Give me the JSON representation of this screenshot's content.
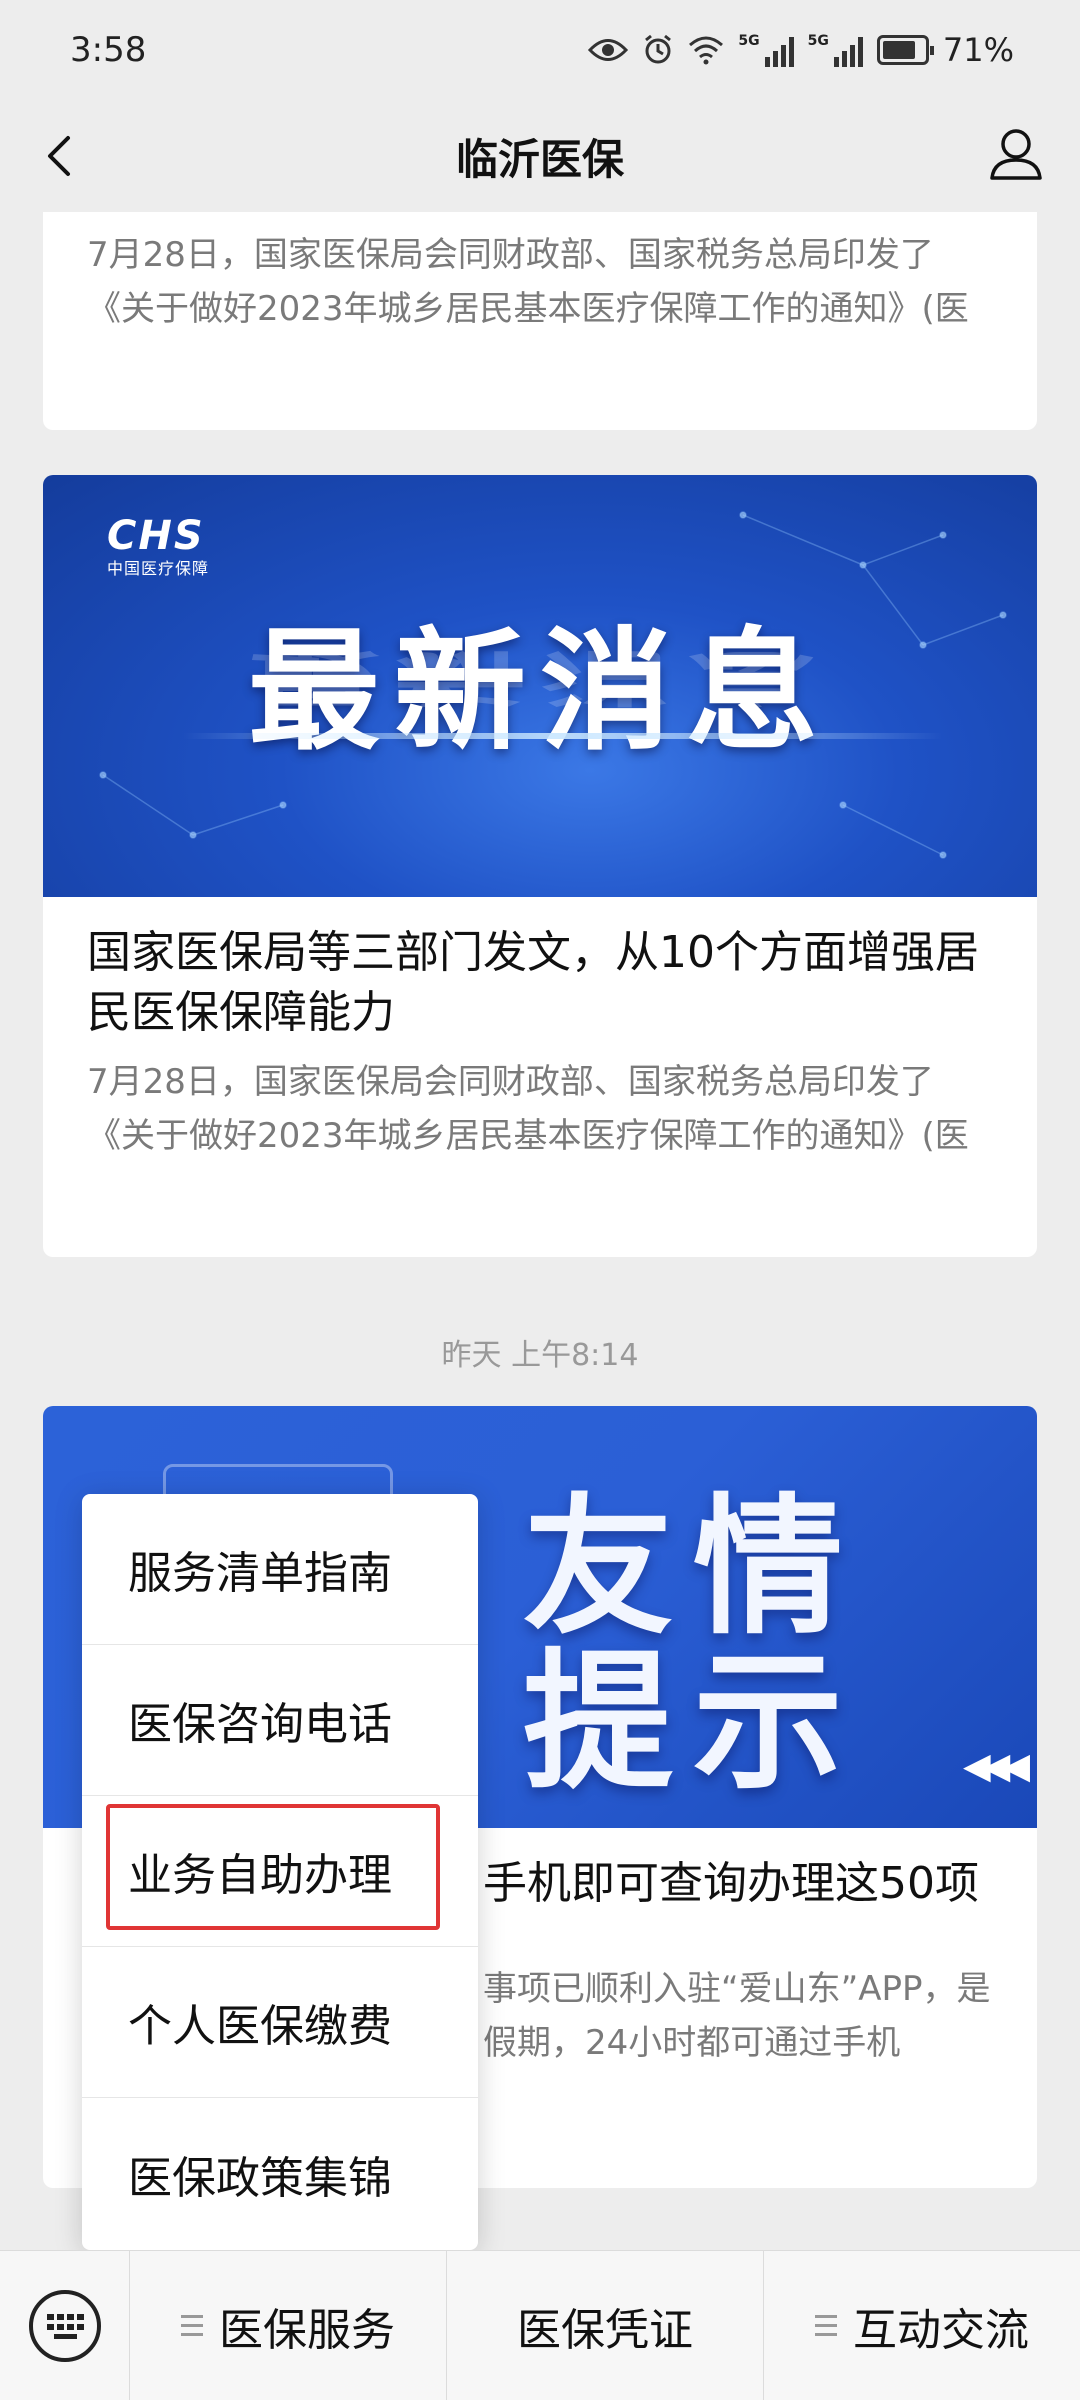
{
  "status_bar": {
    "time": "3:58",
    "battery": "71%",
    "net1": "5G",
    "net2": "5G"
  },
  "header": {
    "title": "临沂医保"
  },
  "articles": [
    {
      "summary": "7月28日，国家医保局会同财政部、国家税务总局印发了《关于做好2023年城乡居民基本医疗保障工作的通知》(医"
    },
    {
      "banner_title": "最新消息",
      "banner_logo": "CHS",
      "banner_logo_sub": "中国医疗保障",
      "headline": "国家医保局等三部门发文，从10个方面增强居民医保保障能力",
      "summary": "7月28日，国家医保局会同财政部、国家税务总局印发了《关于做好2023年城乡居民基本医疗保障工作的通知》(医"
    },
    {
      "banner_line1": "友情",
      "banner_line2": "提示",
      "headline": "手机即可查询办理这50项",
      "summary": "事项已顺利入驻“爱山东”APP，是假期，24小时都可通过手机"
    }
  ],
  "timestamp": "昨天 上午8:14",
  "popup_menu": {
    "items": [
      "服务清单指南",
      "医保咨询电话",
      "业务自助办理",
      "个人医保缴费",
      "医保政策集锦"
    ],
    "highlighted_index": 2,
    "highlight_color": "#e03535"
  },
  "bottom_nav": {
    "items": [
      {
        "label": "医保服务",
        "has_menu_icon": true
      },
      {
        "label": "医保凭证",
        "has_menu_icon": false
      },
      {
        "label": "互动交流",
        "has_menu_icon": true
      }
    ]
  },
  "colors": {
    "banner_blue": "#1f52c6",
    "background": "#ededed"
  }
}
